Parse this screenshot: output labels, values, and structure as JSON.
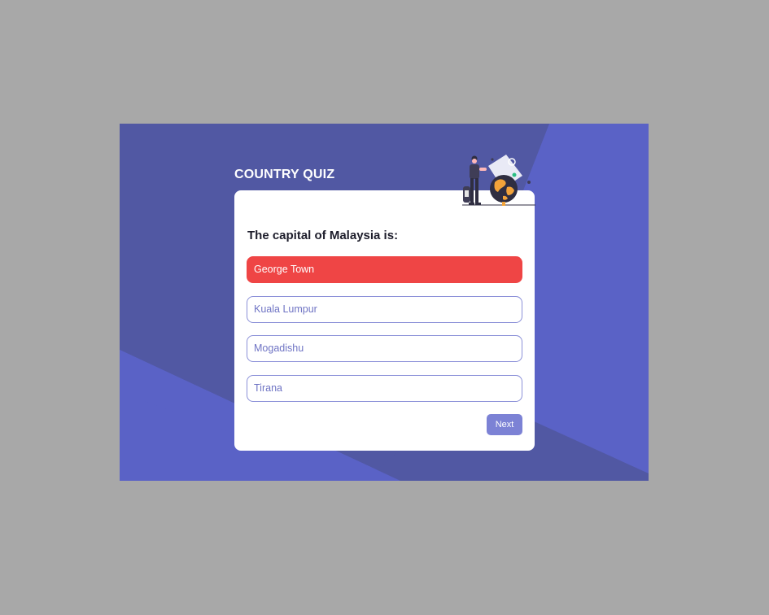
{
  "app": {
    "title": "COUNTRY QUIZ"
  },
  "question": {
    "text": "The capital of Malaysia is:"
  },
  "options": [
    {
      "label": "George Town",
      "state": "wrong"
    },
    {
      "label": "Kuala Lumpur",
      "state": "default"
    },
    {
      "label": "Mogadishu",
      "state": "default"
    },
    {
      "label": "Tirana",
      "state": "default"
    }
  ],
  "actions": {
    "next_label": "Next"
  },
  "colors": {
    "page_background": "#a8a8a8",
    "primary": "#5a62c6",
    "primary_dark": "#5158a3",
    "wrong": "#ef4545",
    "option_border": "#8b90d8",
    "button": "#7c82d5"
  },
  "icons": {
    "illustration": "traveler-with-globe-illustration"
  }
}
